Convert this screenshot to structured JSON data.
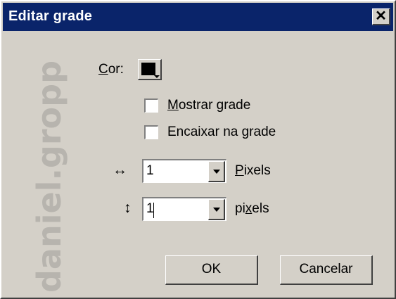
{
  "window": {
    "title": "Editar grade",
    "close_glyph": "✕"
  },
  "watermark": "daniel.gropp",
  "color": {
    "label_prefix": "C",
    "label_rest": "or:",
    "value": "#000000"
  },
  "checkboxes": [
    {
      "accel": "M",
      "rest": "ostrar grade",
      "checked": false
    },
    {
      "accel": "",
      "rest": "Encaixar na grade",
      "checked": false
    }
  ],
  "horizontal": {
    "icon_glyph": "↔",
    "value": "1",
    "unit_accel": "P",
    "unit_rest": "ixels"
  },
  "vertical": {
    "icon_glyph": "↕",
    "value": "1",
    "unit_before": "pi",
    "unit_accel": "x",
    "unit_after": "els"
  },
  "buttons": {
    "ok": "OK",
    "cancel": "Cancelar"
  }
}
